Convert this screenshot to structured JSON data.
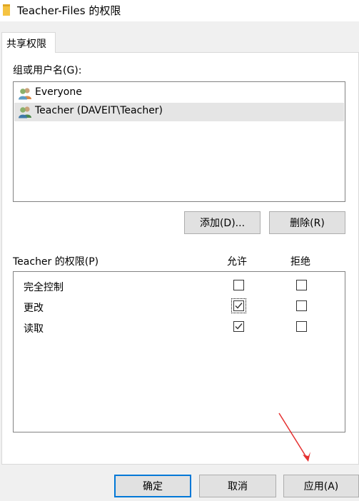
{
  "window": {
    "title": "Teacher-Files 的权限"
  },
  "tabs": [
    {
      "label": "共享权限"
    }
  ],
  "groups": {
    "label": "组或用户名(G):",
    "items": [
      {
        "name": "Everyone",
        "selected": false
      },
      {
        "name": "Teacher (DAVEIT\\Teacher)",
        "selected": true
      }
    ],
    "add_button": "添加(D)...",
    "remove_button": "删除(R)"
  },
  "permissions": {
    "label": "Teacher 的权限(P)",
    "allow_header": "允许",
    "deny_header": "拒绝",
    "rows": [
      {
        "name": "完全控制",
        "allow": false,
        "deny": false
      },
      {
        "name": "更改",
        "allow": true,
        "deny": false
      },
      {
        "name": "读取",
        "allow": true,
        "deny": false
      }
    ]
  },
  "footer": {
    "ok": "确定",
    "cancel": "取消",
    "apply": "应用(A)"
  },
  "colors": {
    "accent": "#0078d7",
    "annotation_arrow": "#e53030"
  }
}
